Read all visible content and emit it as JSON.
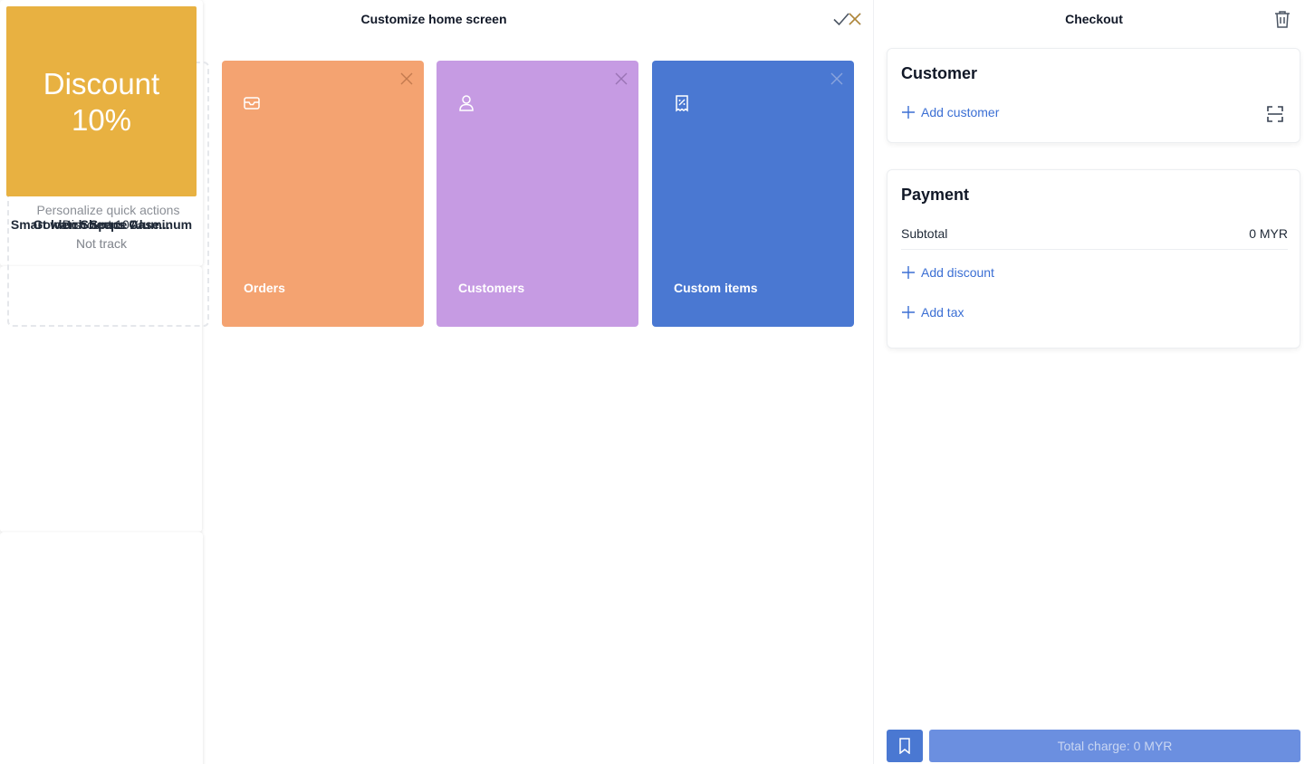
{
  "header": {
    "title": "Customize home screen"
  },
  "quick_actions": {
    "add_label": "Personalize quick actions",
    "items": [
      {
        "label": "Orders",
        "color": "#f4a371",
        "icon": "inbox-icon"
      },
      {
        "label": "Customers",
        "color": "#c69be3",
        "icon": "user-icon"
      },
      {
        "label": "Custom items",
        "color": "#4a78d2",
        "icon": "receipt-icon"
      }
    ]
  },
  "products": [
    {
      "name": "Golden Sheeps Case...",
      "subtitle": "Not track",
      "image": "red-headphones"
    },
    {
      "name": "Smart watch Space Aluminum",
      "subtitle": "Not track",
      "image": "smart-watch"
    },
    {
      "name": "Discount 10%",
      "tile_text": "Discount\n10%",
      "tile_color": "#e8b141"
    }
  ],
  "checkout": {
    "title": "Checkout",
    "customer": {
      "heading": "Customer",
      "add_label": "Add customer"
    },
    "payment": {
      "heading": "Payment",
      "subtotal_label": "Subtotal",
      "subtotal_value": "0 MYR",
      "add_discount_label": "Add discount",
      "add_tax_label": "Add tax"
    },
    "total_label": "Total charge: 0 MYR"
  },
  "colors": {
    "accent": "#4a78d2",
    "link": "#3b6fd4"
  }
}
